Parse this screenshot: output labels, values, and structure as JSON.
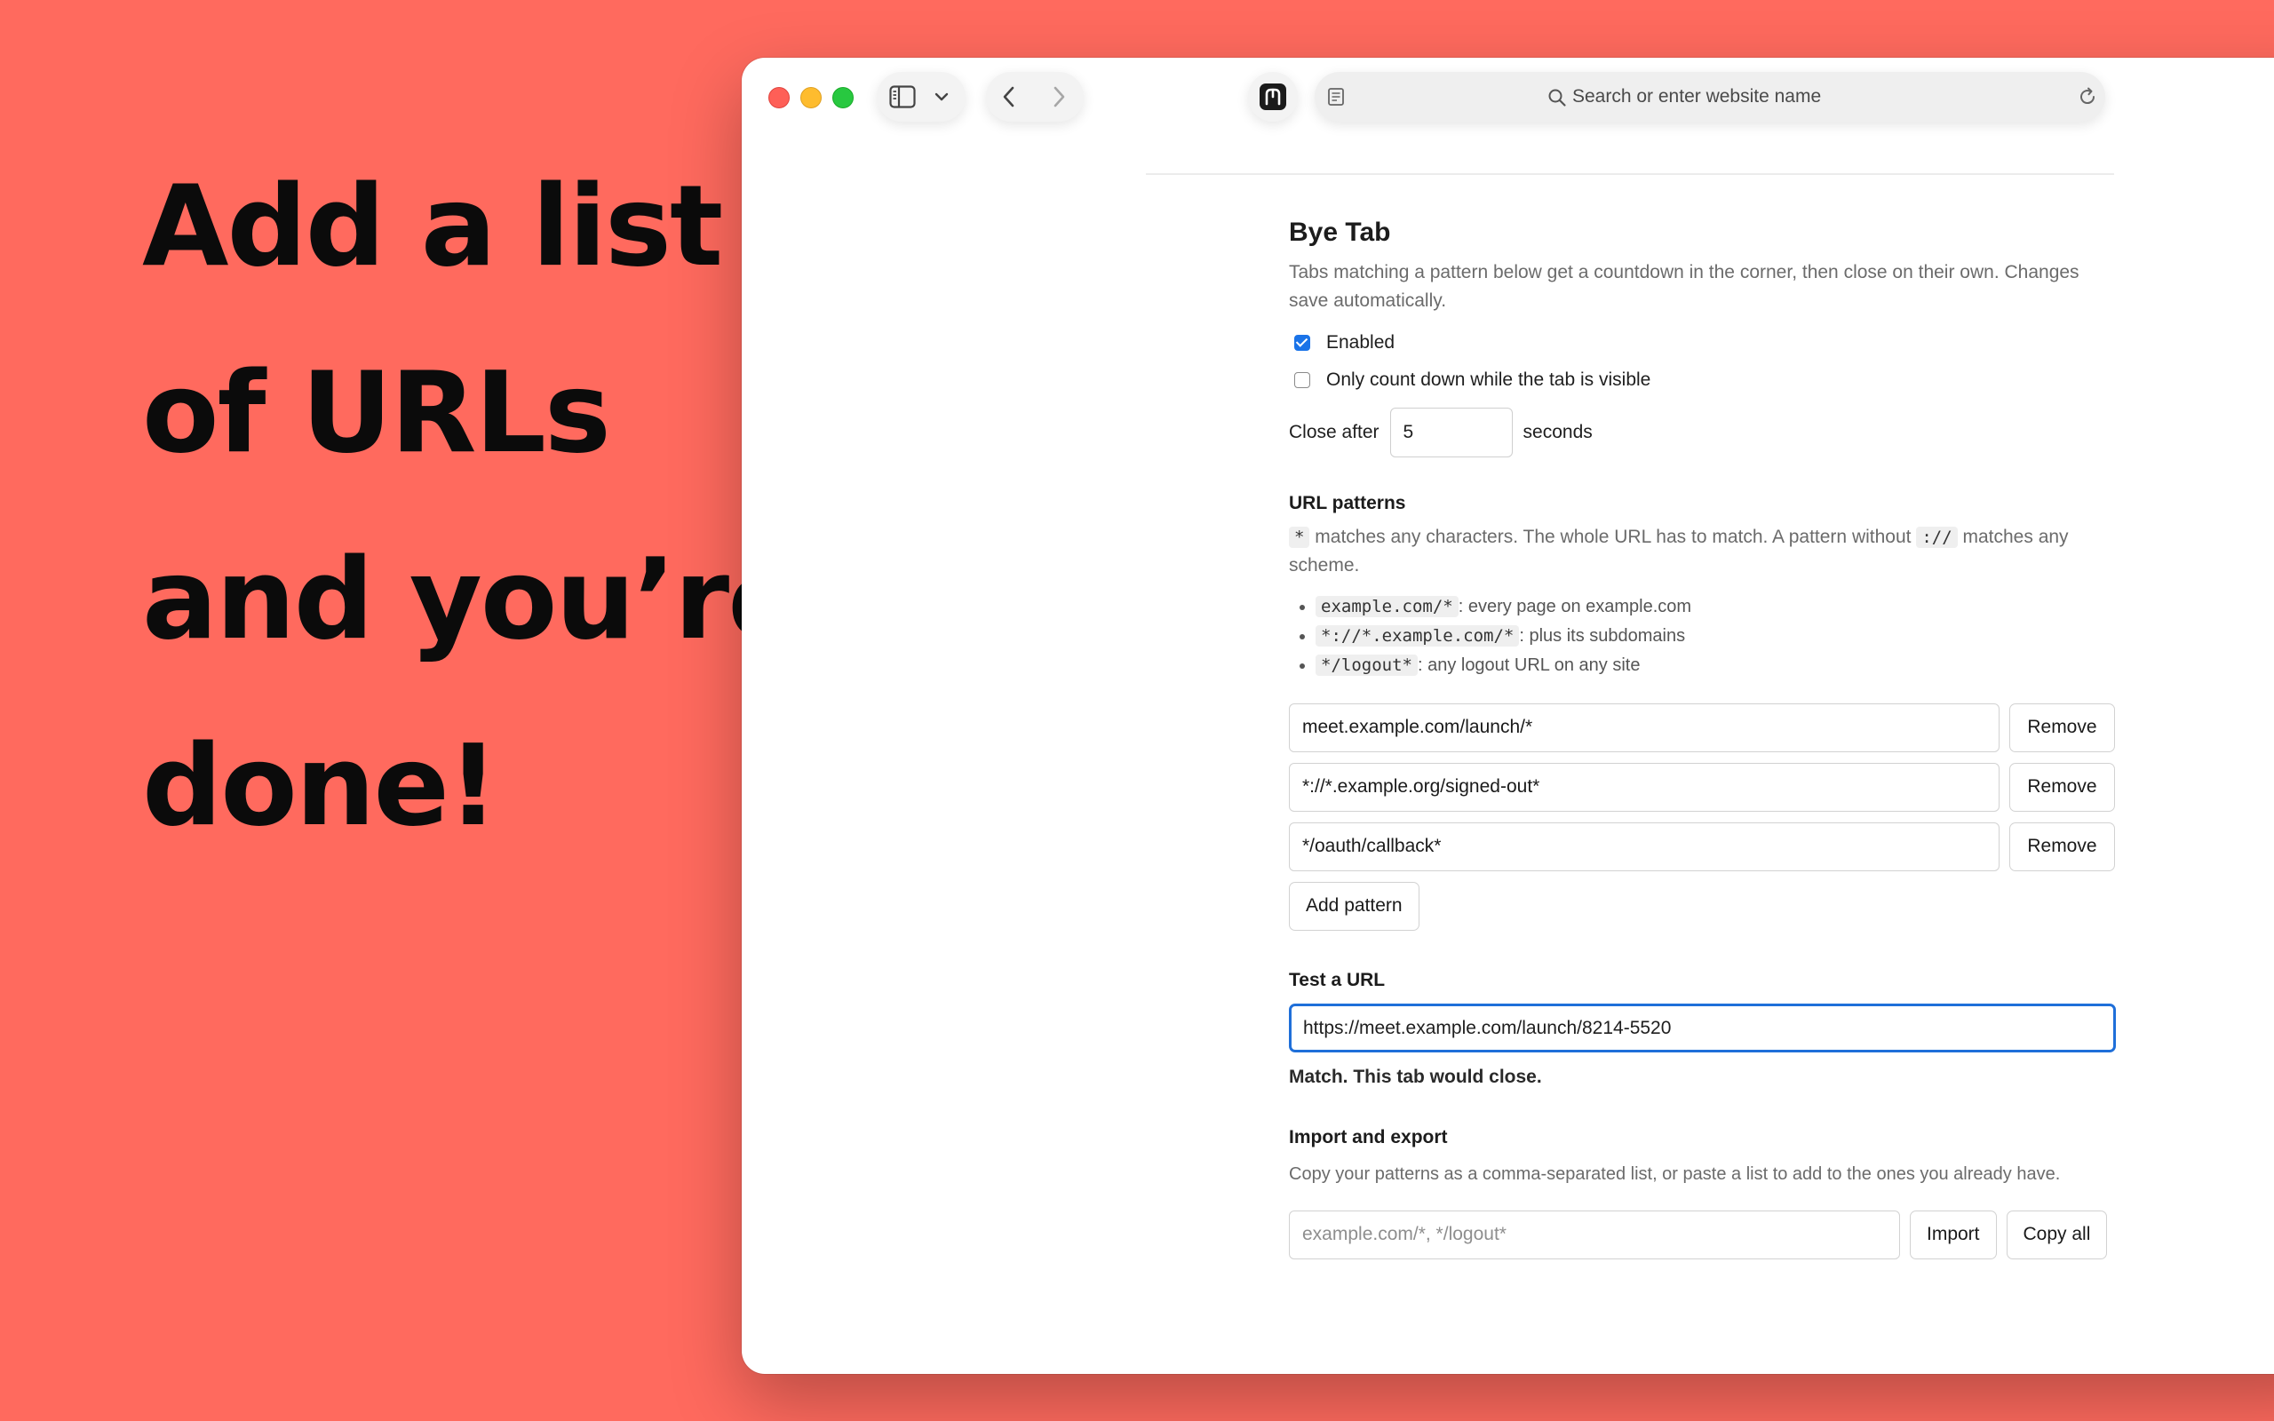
{
  "headline": [
    "Add a list",
    "of URLs",
    "and you’re",
    "done!"
  ],
  "browser": {
    "address_placeholder": "Search or enter website name",
    "icons": [
      "sidebar-icon",
      "chevron-down-icon",
      "back-icon",
      "forward-icon",
      "extension-icon",
      "reader-icon",
      "search-icon",
      "reload-icon"
    ]
  },
  "settings": {
    "title": "Bye Tab",
    "description": "Tabs matching a pattern below get a countdown in the corner, then close on their own. Changes save automatically.",
    "enabled_label": "Enabled",
    "enabled_checked": true,
    "visible_only_label": "Only count down while the tab is visible",
    "visible_only_checked": false,
    "close_after_label": "Close after",
    "close_after_value": "5",
    "seconds_label": "seconds"
  },
  "patterns": {
    "heading": "URL patterns",
    "help_star": "*",
    "help_text_1": "matches any characters. The whole URL has to match. A pattern without",
    "help_scheme": "://",
    "help_text_2": "matches any scheme.",
    "examples": [
      {
        "code": "example.com/*",
        "text": ": every page on example.com"
      },
      {
        "code": "*://*.example.com/*",
        "text": ": plus its subdomains"
      },
      {
        "code": "*/logout*",
        "text": ": any logout URL on any site"
      }
    ],
    "rows": [
      {
        "value": "meet.example.com/launch/*",
        "button": "Remove"
      },
      {
        "value": "*://*.example.org/signed-out*",
        "button": "Remove"
      },
      {
        "value": "*/oauth/callback*",
        "button": "Remove"
      }
    ],
    "add_button": "Add pattern"
  },
  "test": {
    "heading": "Test a URL",
    "value": "https://meet.example.com/launch/8214-5520",
    "result": "Match. This tab would close."
  },
  "import_export": {
    "heading": "Import and export",
    "description": "Copy your patterns as a comma-separated list, or paste a list to add to the ones you already have.",
    "placeholder": "example.com/*, */logout*",
    "import_button": "Import",
    "copy_button": "Copy all"
  },
  "colors": {
    "background": "#ff6a5e",
    "accent": "#1f6fd9"
  }
}
